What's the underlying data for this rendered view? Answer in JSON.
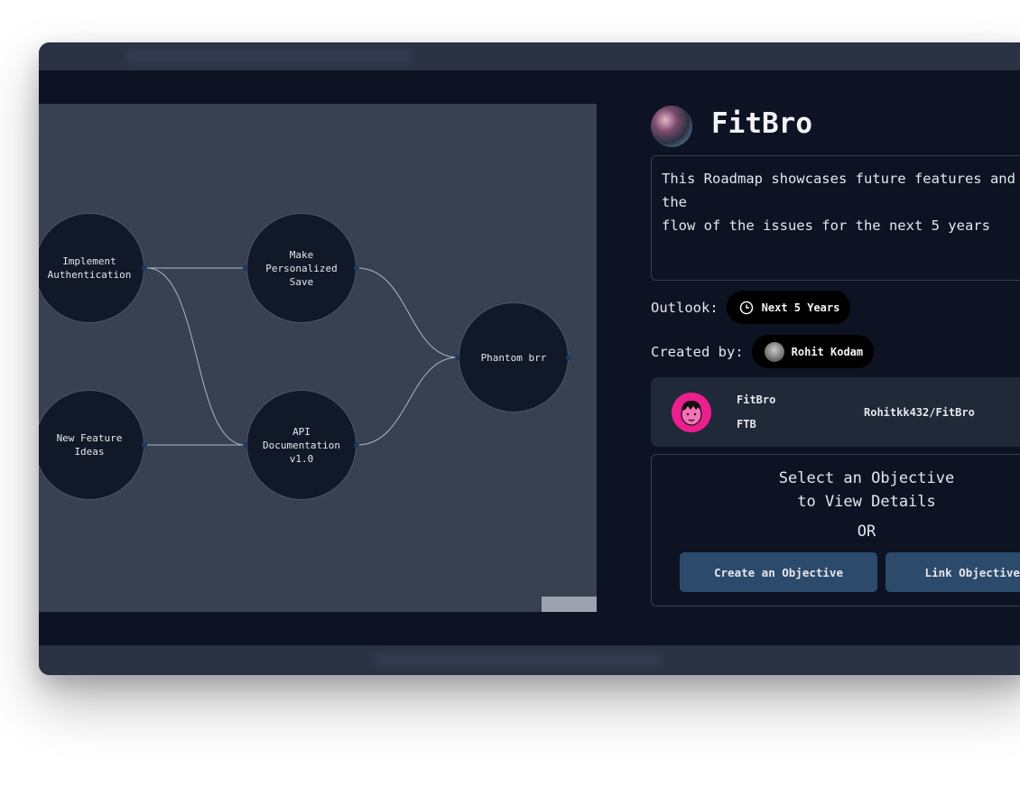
{
  "nodes": [
    {
      "id": "auth",
      "label": "Implement Authentication"
    },
    {
      "id": "ideas",
      "label": "New Feature Ideas"
    },
    {
      "id": "save",
      "label": "Make Personalized Save"
    },
    {
      "id": "api",
      "label": "API Documentation v1.0"
    },
    {
      "id": "phantom",
      "label": "Phantom brr"
    }
  ],
  "edges": [
    [
      "auth",
      "save"
    ],
    [
      "auth",
      "api"
    ],
    [
      "ideas",
      "api"
    ],
    [
      "save",
      "phantom"
    ],
    [
      "api",
      "phantom"
    ]
  ],
  "project": {
    "title": "FitBro",
    "description": "This Roadmap showcases future features and the\nflow of the issues for the next 5 years"
  },
  "outlook": {
    "label": "Outlook:",
    "value": "Next 5 Years",
    "icon": "clock-icon"
  },
  "creator": {
    "label": "Created by:",
    "name": "Rohit Kodam"
  },
  "repo": {
    "name": "FitBro",
    "code": "FTB",
    "path": "Rohitkk432/FitBro"
  },
  "objective": {
    "line1": "Select an Objective",
    "line2": "to View Details",
    "or": "OR",
    "create_label": "Create an Objective",
    "link_label": "Link Objectives"
  },
  "colors": {
    "canvas": "#374151",
    "node": "#111827",
    "button": "#2c4a6b",
    "repo_avatar": "#ec1f8e"
  }
}
